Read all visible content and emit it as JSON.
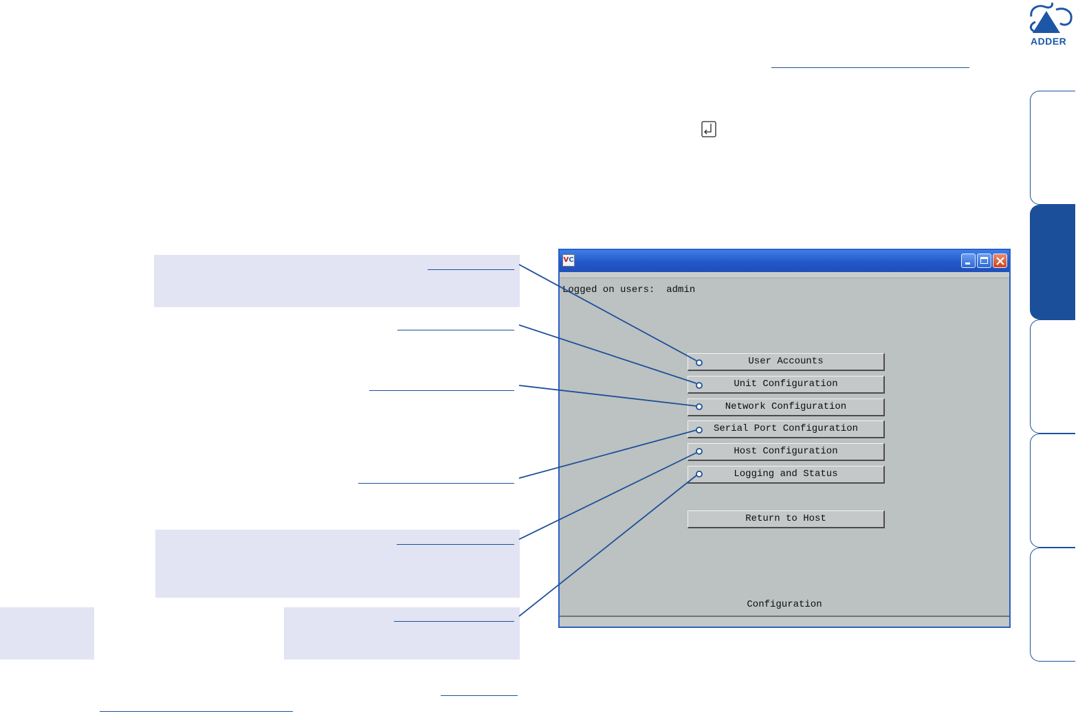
{
  "brand": {
    "logo_text": "ADDER"
  },
  "window": {
    "app_icon": "VC",
    "logged_on_label": "Logged on users:",
    "logged_on_value": "admin",
    "title_buttons": [
      "minimize-icon",
      "maximize-icon",
      "close-icon"
    ],
    "menu_buttons": [
      "User Accounts",
      "Unit Configuration",
      "Network Configuration",
      "Serial Port Configuration",
      "Host Configuration",
      "Logging and Status"
    ],
    "return_button": "Return to Host",
    "footer_label": "Configuration"
  },
  "icons": {
    "enter_key": "enter-key-icon",
    "connector_dot": "hollow-circle-icon"
  },
  "colors": {
    "brand_blue": "#1b4f9a",
    "callout_shade": "#e2e3f3",
    "window_gray": "#bcc1c1",
    "titlebar_blue": "#2358c9"
  }
}
